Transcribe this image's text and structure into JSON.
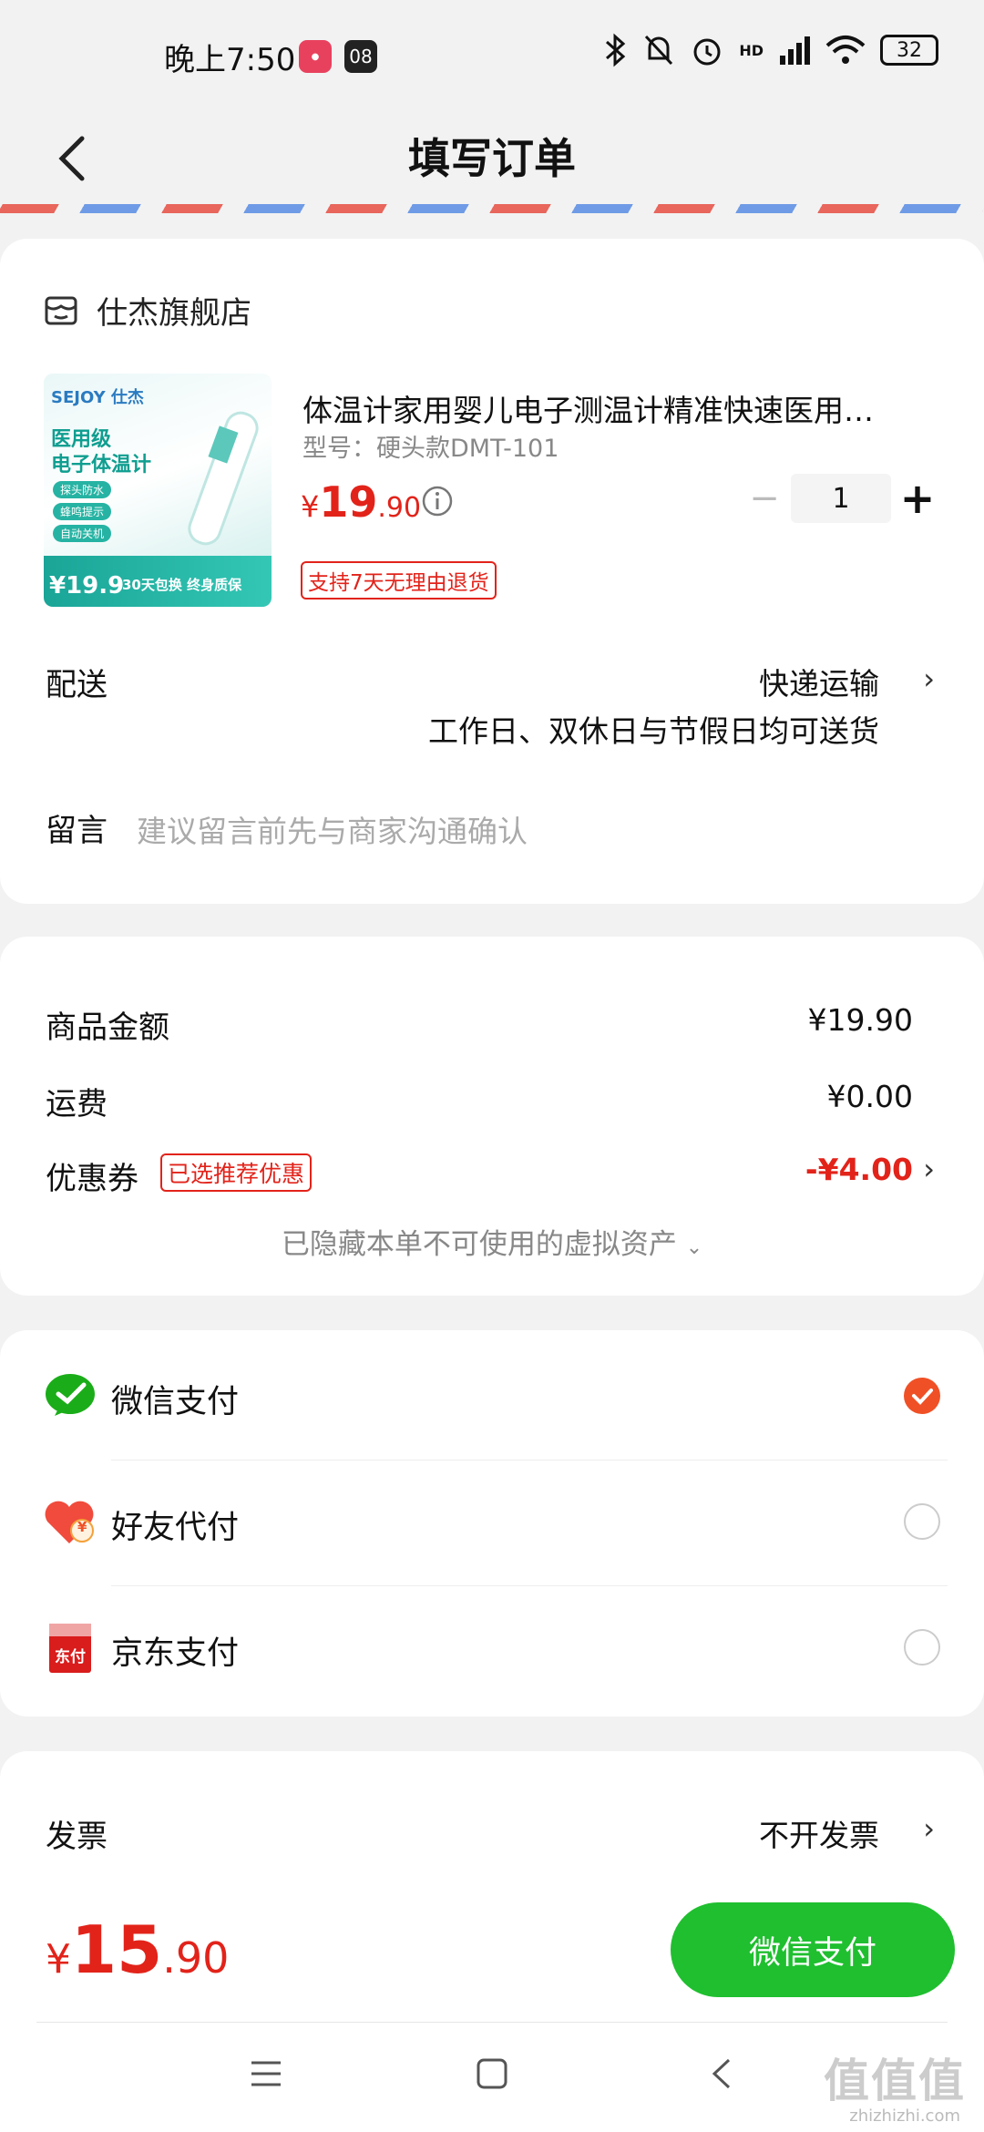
{
  "status_bar": {
    "time": "晚上7:50",
    "app_badge": "08",
    "network": "HD",
    "battery": "32"
  },
  "header": {
    "title": "填写订单"
  },
  "store": {
    "name": "仕杰旗舰店"
  },
  "product": {
    "title": "体温计家用婴儿电子测温计精准快速医用…",
    "spec": "型号：硬头款DMT-101",
    "price_symbol": "¥",
    "price_int": "19",
    "price_dec": ".90",
    "quantity": "1",
    "return_tag": "支持7天无理由退货",
    "image_text": {
      "brand": "SEJOY 仕杰",
      "line1": "医用级",
      "line2": "电子体温计",
      "feature1": "探头防水",
      "feature2": "蜂鸣提示",
      "feature3": "自动关机",
      "price": "¥19.9",
      "guarantee": "30天包换 终身质保"
    }
  },
  "delivery": {
    "label": "配送",
    "method": "快递运输",
    "detail": "工作日、双休日与节假日均可送货"
  },
  "message": {
    "label": "留言",
    "placeholder": "建议留言前先与商家沟通确认"
  },
  "amounts": {
    "goods_label": "商品金额",
    "goods_value": "¥19.90",
    "shipping_label": "运费",
    "shipping_value": "¥0.00",
    "coupon_label": "优惠券",
    "coupon_tag": "已选推荐优惠",
    "coupon_value": "-¥4.00",
    "hidden_note": "已隐藏本单不可使用的虚拟资产"
  },
  "payment": {
    "wechat": "微信支付",
    "friend": "好友代付",
    "jd": "京东支付",
    "friend_badge": "¥",
    "jd_icon_text": "东付"
  },
  "invoice": {
    "label": "发票",
    "value": "不开发票"
  },
  "footer": {
    "total_symbol": "¥",
    "total_int": "15",
    "total_dec": ".90",
    "pay_button": "微信支付"
  },
  "watermark": {
    "main": "值值值",
    "sub": "zhizhizhi.com"
  },
  "colors": {
    "accent_red": "#e2231a",
    "wechat_green": "#1fbf2f",
    "check_orange": "#f05025"
  }
}
